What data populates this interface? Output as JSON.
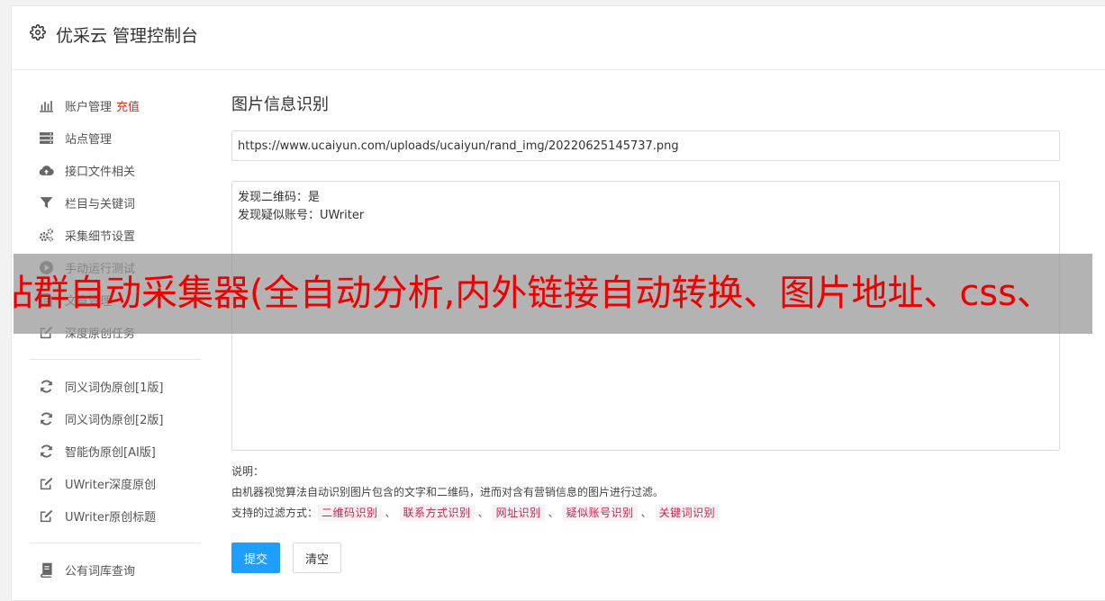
{
  "header": {
    "title": "优采云 管理控制台"
  },
  "sidebar": {
    "groups": [
      [
        {
          "label": "账户管理",
          "extra": "充值",
          "icon": "bar-chart-icon"
        },
        {
          "label": "站点管理",
          "icon": "server-icon"
        },
        {
          "label": "接口文件相关",
          "icon": "cloud-upload-icon"
        },
        {
          "label": "栏目与关键词",
          "icon": "filter-icon"
        },
        {
          "label": "采集细节设置",
          "icon": "gears-icon"
        },
        {
          "label": "手动运行测试",
          "icon": "play-circle-icon"
        },
        {
          "label": "文章管理",
          "icon": "file-icon"
        },
        {
          "label": "深度原创任务",
          "icon": "edit-icon"
        }
      ],
      [
        {
          "label": "同义词伪原创[1版]",
          "icon": "refresh-icon"
        },
        {
          "label": "同义词伪原创[2版]",
          "icon": "refresh-icon"
        },
        {
          "label": "智能伪原创[AI版]",
          "icon": "refresh-icon"
        },
        {
          "label": "UWriter深度原创",
          "icon": "edit-icon"
        },
        {
          "label": "UWriter原创标题",
          "icon": "edit-icon"
        }
      ],
      [
        {
          "label": "公有词库查询",
          "icon": "book-icon"
        }
      ]
    ]
  },
  "main": {
    "title": "图片信息识别",
    "url_value": "https://www.ucaiyun.com/uploads/ucaiyun/rand_img/20220625145737.png",
    "result_text": "发现二维码：是\n发现疑似账号：UWriter",
    "desc_label": "说明：",
    "desc_text": "由机器视觉算法自动识别图片包含的文字和二维码，进而对含有营销信息的图片进行过滤。",
    "filter_label": "支持的过滤方式：",
    "filter_tags": [
      "二维码识别",
      "联系方式识别",
      "网址识别",
      "疑似账号识别",
      "关键词识别"
    ],
    "filter_separator": "、",
    "submit_label": "提交",
    "clear_label": "清空"
  },
  "overlay": {
    "text": "站群自动采集器(全自动分析,内外链接自动转换、图片地址、css、"
  },
  "colors": {
    "primary": "#1e9fff",
    "accent_red": "#e0301e",
    "tag_text": "#c7254e",
    "tag_bg": "#f9f2f4"
  }
}
